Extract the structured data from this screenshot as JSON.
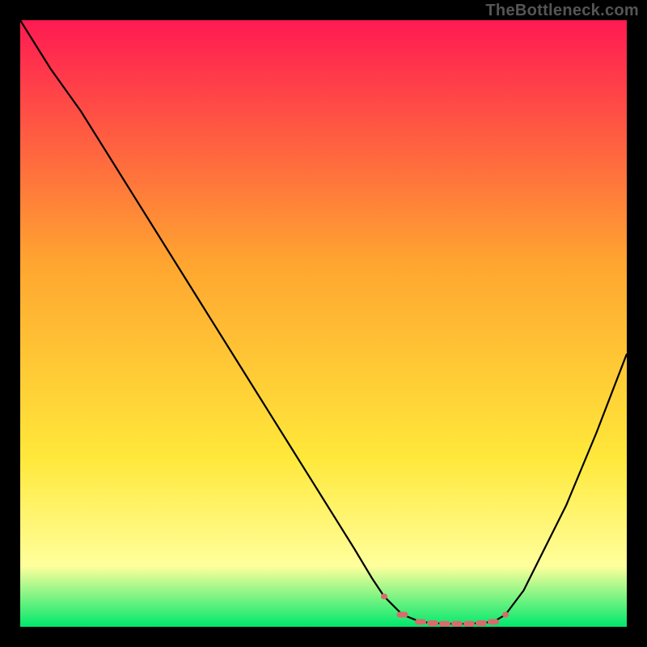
{
  "watermark": "TheBottleneck.com",
  "colors": {
    "frame": "#000000",
    "gradient_top": "#ff1a52",
    "gradient_mid": "#ffa530",
    "gradient_low": "#ffe83a",
    "gradient_pale": "#ffff9c",
    "gradient_bottom": "#00e86c",
    "curve": "#000000",
    "marker": "#d66c6c"
  },
  "chart_data": {
    "type": "line",
    "title": "",
    "xlabel": "",
    "ylabel": "",
    "xlim": [
      0,
      100
    ],
    "ylim": [
      0,
      100
    ],
    "series": [
      {
        "name": "bottleneck-curve",
        "x": [
          0,
          5,
          10,
          15,
          20,
          25,
          30,
          35,
          40,
          45,
          50,
          55,
          58,
          60,
          63,
          66,
          70,
          74,
          78,
          80,
          83,
          86,
          90,
          95,
          100
        ],
        "values": [
          100,
          92,
          85,
          77,
          69,
          61,
          53,
          45,
          37,
          29,
          21,
          13,
          8,
          5,
          2,
          0.8,
          0.5,
          0.5,
          0.8,
          2,
          6,
          12,
          20,
          32,
          45
        ]
      }
    ],
    "markers": {
      "name": "optimal-range",
      "x": [
        60,
        63,
        66,
        68,
        70,
        72,
        74,
        76,
        78,
        80
      ],
      "values": [
        5,
        2,
        0.8,
        0.6,
        0.5,
        0.5,
        0.5,
        0.6,
        0.8,
        2
      ]
    }
  }
}
